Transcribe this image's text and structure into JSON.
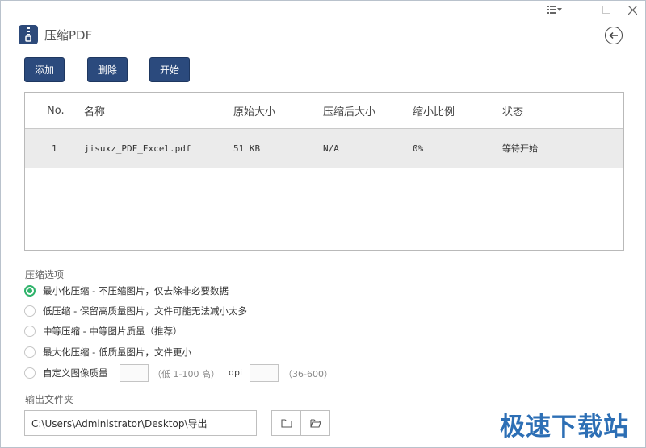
{
  "app": {
    "title": "压缩PDF"
  },
  "toolbar": {
    "add_label": "添加",
    "delete_label": "删除",
    "start_label": "开始"
  },
  "table": {
    "headers": [
      "No.",
      "名称",
      "原始大小",
      "压缩后大小",
      "缩小比例",
      "状态"
    ],
    "rows": [
      {
        "no": "1",
        "name": "jisuxz_PDF_Excel.pdf",
        "original_size": "51 KB",
        "compressed_size": "N/A",
        "ratio": "0%",
        "status": "等待开始"
      }
    ]
  },
  "compression": {
    "section_label": "压缩选项",
    "options": [
      {
        "label": "最小化压缩 - 不压缩图片，仅去除非必要数据",
        "checked": true
      },
      {
        "label": "低压缩 - 保留高质量图片，文件可能无法减小太多",
        "checked": false
      },
      {
        "label": "中等压缩 - 中等图片质量（推荐）",
        "checked": false
      },
      {
        "label": "最大化压缩 - 低质量图片，文件更小",
        "checked": false
      },
      {
        "label": "自定义图像质量",
        "checked": false
      }
    ],
    "quality_value": "",
    "quality_hint": "（低 1-100 高）",
    "dpi_label": "dpi",
    "dpi_value": "",
    "dpi_hint": "（36-600）"
  },
  "output": {
    "section_label": "输出文件夹",
    "path": "C:\\Users\\Administrator\\Desktop\\导出"
  },
  "watermark": "极速下载站",
  "colors": {
    "accent": "#2b4a7d",
    "radio_checked": "#2fb36b",
    "watermark": "#2d6fb5"
  }
}
